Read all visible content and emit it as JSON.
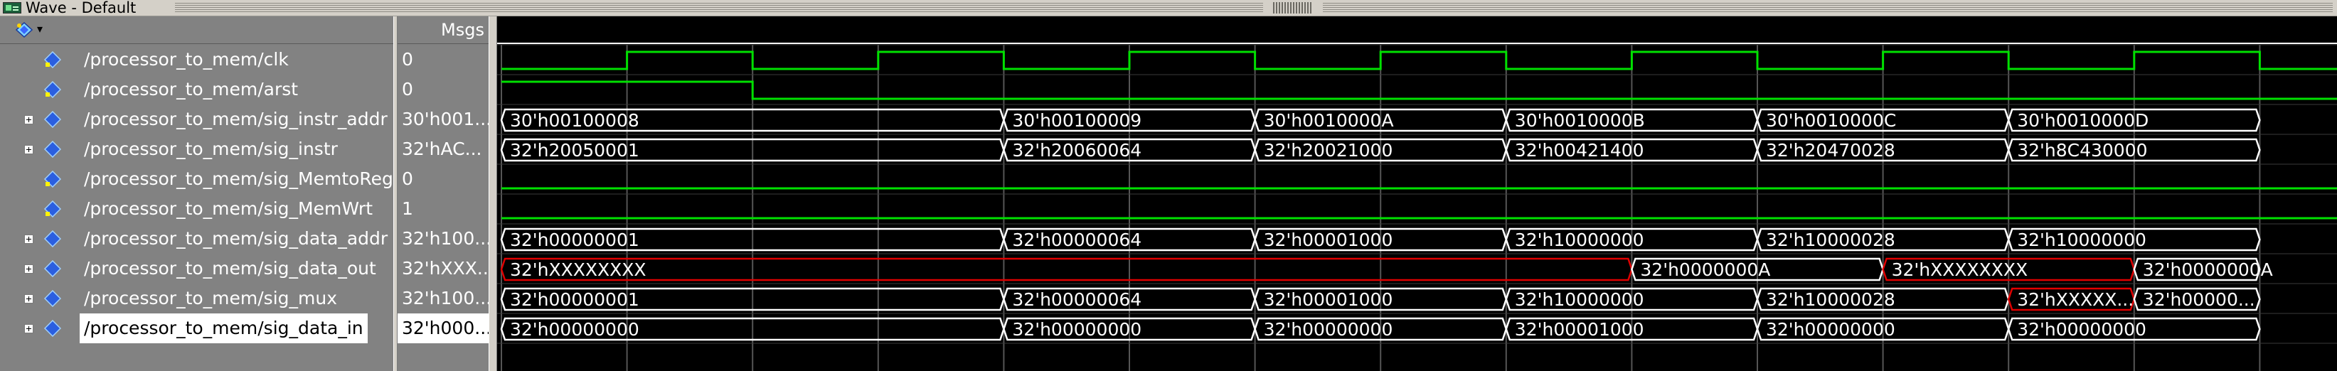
{
  "window": {
    "title": "Wave - Default"
  },
  "header": {
    "msgs_label": "Msgs",
    "toolbar_icon": "wave-diamond-icon",
    "dropdown_icon": "dropdown-arrow-icon"
  },
  "colors": {
    "background": "#000000",
    "pane": "#828282",
    "wave_green": "#00e000",
    "bus_white": "#ffffff",
    "unknown_red": "#e00000",
    "grid": "#555555"
  },
  "signals": [
    {
      "name": "/processor_to_mem/clk",
      "value": "0",
      "type": "bit",
      "expandable": false,
      "selected": false
    },
    {
      "name": "/processor_to_mem/arst",
      "value": "0",
      "type": "bit",
      "expandable": false,
      "selected": false
    },
    {
      "name": "/processor_to_mem/sig_instr_addr",
      "value": "30'h001...",
      "type": "bus",
      "expandable": true,
      "selected": false
    },
    {
      "name": "/processor_to_mem/sig_instr",
      "value": "32'hAC...",
      "type": "bus",
      "expandable": true,
      "selected": false
    },
    {
      "name": "/processor_to_mem/sig_MemtoReg",
      "value": "0",
      "type": "bit",
      "expandable": false,
      "selected": false
    },
    {
      "name": "/processor_to_mem/sig_MemWrt",
      "value": "1",
      "type": "bit",
      "expandable": false,
      "selected": false
    },
    {
      "name": "/processor_to_mem/sig_data_addr",
      "value": "32'h100...",
      "type": "bus",
      "expandable": true,
      "selected": false
    },
    {
      "name": "/processor_to_mem/sig_data_out",
      "value": "32'hXXX...",
      "type": "bus",
      "expandable": true,
      "selected": false
    },
    {
      "name": "/processor_to_mem/sig_mux",
      "value": "32'h100...",
      "type": "bus",
      "expandable": true,
      "selected": false
    },
    {
      "name": "/processor_to_mem/sig_data_in",
      "value": "32'h000...",
      "type": "bus",
      "expandable": true,
      "selected": true
    }
  ],
  "waves": {
    "clk": [
      0,
      1,
      0,
      1,
      0,
      1,
      0,
      1,
      0,
      1,
      0,
      1,
      0,
      1,
      0,
      1,
      0,
      1,
      0,
      1,
      0,
      1,
      0,
      1,
      0,
      1,
      0,
      1
    ],
    "arst": [
      1,
      1,
      0,
      0,
      0,
      0,
      0,
      0,
      0,
      0,
      0,
      0,
      0,
      0,
      0,
      0,
      0,
      0,
      0,
      0,
      0,
      0,
      0,
      0,
      0,
      0,
      0,
      0
    ],
    "MemtoReg": [
      0,
      0,
      0,
      0,
      0,
      0,
      0,
      0,
      0,
      0,
      0,
      0,
      0,
      0,
      0,
      0,
      0,
      0,
      0,
      0,
      0,
      0,
      0,
      0,
      0,
      0,
      0,
      0
    ],
    "MemWrt": [
      0,
      0,
      0,
      0,
      0,
      0,
      0,
      0,
      0,
      0,
      0,
      0,
      0,
      0,
      0,
      0,
      0,
      0,
      0,
      0,
      0,
      0,
      0,
      0,
      0,
      0,
      0,
      1
    ],
    "sig_instr_addr": [
      {
        "start": 0,
        "end": 4,
        "label": "30'h00100008",
        "unknown": false
      },
      {
        "start": 4,
        "end": 6,
        "label": "30'h00100009",
        "unknown": false
      },
      {
        "start": 6,
        "end": 8,
        "label": "30'h0010000A",
        "unknown": false
      },
      {
        "start": 8,
        "end": 10,
        "label": "30'h0010000B",
        "unknown": false
      },
      {
        "start": 10,
        "end": 12,
        "label": "30'h0010000C",
        "unknown": false
      },
      {
        "start": 12,
        "end": 14,
        "label": "30'h0010000D",
        "unknown": false
      }
    ],
    "sig_instr": [
      {
        "start": 0,
        "end": 4,
        "label": "32'h20050001",
        "unknown": false
      },
      {
        "start": 4,
        "end": 6,
        "label": "32'h20060064",
        "unknown": false
      },
      {
        "start": 6,
        "end": 8,
        "label": "32'h20021000",
        "unknown": false
      },
      {
        "start": 8,
        "end": 10,
        "label": "32'h00421400",
        "unknown": false
      },
      {
        "start": 10,
        "end": 12,
        "label": "32'h20470028",
        "unknown": false
      },
      {
        "start": 12,
        "end": 14,
        "label": "32'h8C430000",
        "unknown": false
      }
    ],
    "sig_data_addr": [
      {
        "start": 0,
        "end": 4,
        "label": "32'h00000001",
        "unknown": false
      },
      {
        "start": 4,
        "end": 6,
        "label": "32'h00000064",
        "unknown": false
      },
      {
        "start": 6,
        "end": 8,
        "label": "32'h00001000",
        "unknown": false
      },
      {
        "start": 8,
        "end": 10,
        "label": "32'h10000000",
        "unknown": false
      },
      {
        "start": 10,
        "end": 12,
        "label": "32'h10000028",
        "unknown": false
      },
      {
        "start": 12,
        "end": 14,
        "label": "32'h10000000",
        "unknown": false
      }
    ],
    "sig_data_out": [
      {
        "start": 0,
        "end": 9,
        "label": "32'hXXXXXXXX",
        "unknown": true
      },
      {
        "start": 9,
        "end": 11,
        "label": "32'h0000000A",
        "unknown": false
      },
      {
        "start": 11,
        "end": 13,
        "label": "32'hXXXXXXXX",
        "unknown": true
      },
      {
        "start": 13,
        "end": 14,
        "label": "32'h0000000A",
        "unknown": false
      }
    ],
    "sig_mux": [
      {
        "start": 0,
        "end": 4,
        "label": "32'h00000001",
        "unknown": false
      },
      {
        "start": 4,
        "end": 6,
        "label": "32'h00000064",
        "unknown": false
      },
      {
        "start": 6,
        "end": 8,
        "label": "32'h00001000",
        "unknown": false
      },
      {
        "start": 8,
        "end": 10,
        "label": "32'h10000000",
        "unknown": false
      },
      {
        "start": 10,
        "end": 12,
        "label": "32'h10000028",
        "unknown": false
      },
      {
        "start": 12,
        "end": 13,
        "label": "32'hXXXXX...",
        "unknown": true
      },
      {
        "start": 13,
        "end": 14,
        "label": "32'h00000...",
        "unknown": false
      }
    ],
    "sig_data_in": [
      {
        "start": 0,
        "end": 4,
        "label": "32'h00000000",
        "unknown": false
      },
      {
        "start": 4,
        "end": 6,
        "label": "32'h00000000",
        "unknown": false
      },
      {
        "start": 6,
        "end": 8,
        "label": "32'h00000000",
        "unknown": false
      },
      {
        "start": 8,
        "end": 10,
        "label": "32'h00001000",
        "unknown": false
      },
      {
        "start": 10,
        "end": 12,
        "label": "32'h00000000",
        "unknown": false
      },
      {
        "start": 12,
        "end": 14,
        "label": "32'h00000000",
        "unknown": false
      }
    ]
  }
}
